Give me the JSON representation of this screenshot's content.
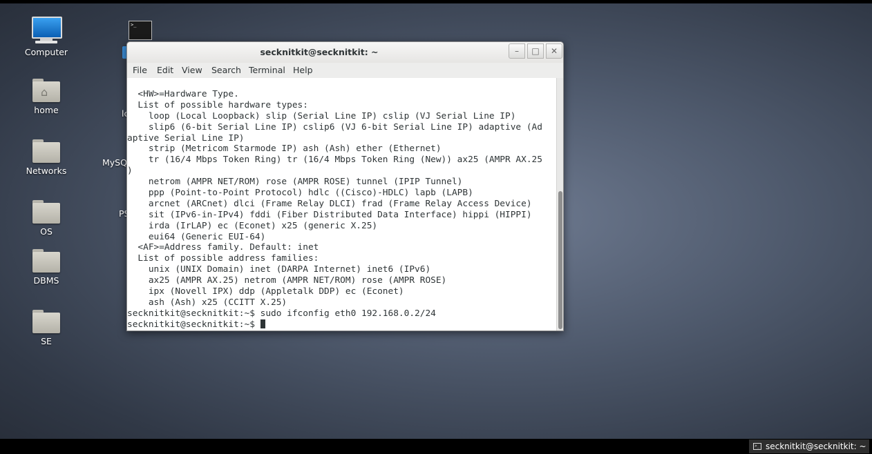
{
  "desktop": {
    "icons": [
      {
        "label": "Computer",
        "icon": "computer-icon"
      },
      {
        "label": "home",
        "icon": "home-folder-icon"
      },
      {
        "label": "Networks",
        "icon": "folder-icon"
      },
      {
        "label": "OS",
        "icon": "folder-icon"
      },
      {
        "label": "DBMS",
        "icon": "folder-icon"
      },
      {
        "label": "SE",
        "icon": "folder-icon"
      }
    ],
    "partial_labels": [
      "lc",
      "MySQ",
      "PS"
    ]
  },
  "window": {
    "title": "secknitkit@secknitkit: ~",
    "buttons": {
      "minimize": "–",
      "maximize": "□",
      "close": "✕"
    },
    "menu": [
      "File",
      "Edit",
      "View",
      "Search",
      "Terminal",
      "Help"
    ]
  },
  "terminal": {
    "lines": [
      "  <HW>=Hardware Type.",
      "  List of possible hardware types:",
      "    loop (Local Loopback) slip (Serial Line IP) cslip (VJ Serial Line IP)",
      "    slip6 (6-bit Serial Line IP) cslip6 (VJ 6-bit Serial Line IP) adaptive (Ad",
      "aptive Serial Line IP)",
      "    strip (Metricom Starmode IP) ash (Ash) ether (Ethernet)",
      "    tr (16/4 Mbps Token Ring) tr (16/4 Mbps Token Ring (New)) ax25 (AMPR AX.25",
      ")",
      "    netrom (AMPR NET/ROM) rose (AMPR ROSE) tunnel (IPIP Tunnel)",
      "    ppp (Point-to-Point Protocol) hdlc ((Cisco)-HDLC) lapb (LAPB)",
      "    arcnet (ARCnet) dlci (Frame Relay DLCI) frad (Frame Relay Access Device)",
      "    sit (IPv6-in-IPv4) fddi (Fiber Distributed Data Interface) hippi (HIPPI)",
      "    irda (IrLAP) ec (Econet) x25 (generic X.25)",
      "    eui64 (Generic EUI-64)",
      "  <AF>=Address family. Default: inet",
      "  List of possible address families:",
      "    unix (UNIX Domain) inet (DARPA Internet) inet6 (IPv6)",
      "    ax25 (AMPR AX.25) netrom (AMPR NET/ROM) rose (AMPR ROSE)",
      "    ipx (Novell IPX) ddp (Appletalk DDP) ec (Econet)",
      "    ash (Ash) x25 (CCITT X.25)",
      "secknitkit@secknitkit:~$ sudo ifconfig eth0 192.168.0.2/24"
    ],
    "prompt": "secknitkit@secknitkit:~$ "
  },
  "taskbar": {
    "task_label": "secknitkit@secknitkit: ~"
  }
}
